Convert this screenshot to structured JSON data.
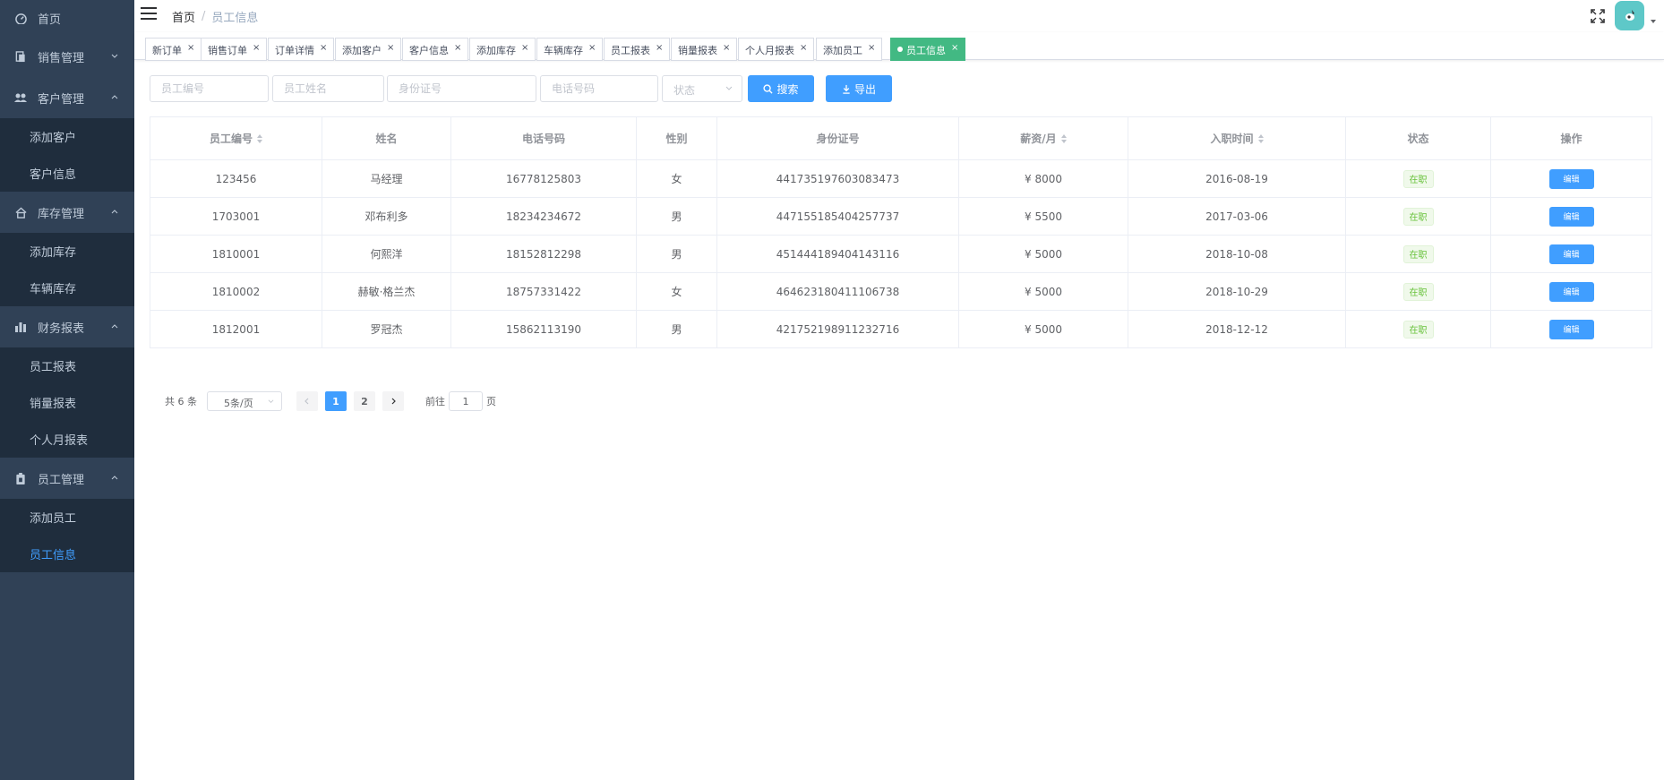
{
  "sidebar": {
    "items": [
      {
        "label": "首页",
        "icon": "dashboard-icon"
      },
      {
        "label": "销售管理",
        "icon": "document-icon",
        "expanded": false
      },
      {
        "label": "客户管理",
        "icon": "peoples-icon",
        "expanded": true,
        "children": [
          "添加客户",
          "客户信息"
        ]
      },
      {
        "label": "库存管理",
        "icon": "home-icon",
        "expanded": true,
        "children": [
          "添加库存",
          "车辆库存"
        ]
      },
      {
        "label": "财务报表",
        "icon": "bar-chart-icon",
        "expanded": true,
        "children": [
          "员工报表",
          "销量报表",
          "个人月报表"
        ]
      },
      {
        "label": "员工管理",
        "icon": "clipboard-icon",
        "expanded": true,
        "children": [
          "添加员工",
          "员工信息"
        ]
      }
    ],
    "active_child": "员工信息",
    "colors": {
      "bg": "#304156",
      "submenu_bg": "#1f2d3d",
      "text": "#bfcbd9",
      "active": "#409eff"
    }
  },
  "header": {
    "breadcrumb": {
      "home": "首页",
      "separator": "/",
      "current": "员工信息"
    }
  },
  "tags": [
    {
      "label": "新订单"
    },
    {
      "label": "销售订单"
    },
    {
      "label": "订单详情"
    },
    {
      "label": "添加客户"
    },
    {
      "label": "客户信息"
    },
    {
      "label": "添加库存"
    },
    {
      "label": "车辆库存"
    },
    {
      "label": "员工报表"
    },
    {
      "label": "销量报表"
    },
    {
      "label": "个人月报表"
    },
    {
      "label": "添加员工"
    },
    {
      "label": "员工信息",
      "active": true
    }
  ],
  "tag_close": "×",
  "filters": {
    "employee_id_placeholder": "员工编号",
    "employee_name_placeholder": "员工姓名",
    "id_card_placeholder": "身份证号",
    "phone_placeholder": "电话号码",
    "status_placeholder": "状态",
    "search_label": "搜索",
    "export_label": "导出"
  },
  "table": {
    "columns": [
      "员工编号",
      "姓名",
      "电话号码",
      "性别",
      "身份证号",
      "薪资/月",
      "入职时间",
      "状态",
      "操作"
    ],
    "rows": [
      {
        "id": "123456",
        "name": "马经理",
        "phone": "16778125803",
        "gender": "女",
        "id_card": "441735197603083473",
        "salary": "¥ 8000",
        "hire_date": "2016-08-19",
        "status": "在职",
        "action": "编辑"
      },
      {
        "id": "1703001",
        "name": "邓布利多",
        "phone": "18234234672",
        "gender": "男",
        "id_card": "447155185404257737",
        "salary": "¥ 5500",
        "hire_date": "2017-03-06",
        "status": "在职",
        "action": "编辑"
      },
      {
        "id": "1810001",
        "name": "何熙洋",
        "phone": "18152812298",
        "gender": "男",
        "id_card": "451444189404143116",
        "salary": "¥ 5000",
        "hire_date": "2018-10-08",
        "status": "在职",
        "action": "编辑"
      },
      {
        "id": "1810002",
        "name": "赫敏·格兰杰",
        "phone": "18757331422",
        "gender": "女",
        "id_card": "464623180411106738",
        "salary": "¥ 5000",
        "hire_date": "2018-10-29",
        "status": "在职",
        "action": "编辑"
      },
      {
        "id": "1812001",
        "name": "罗冠杰",
        "phone": "15862113190",
        "gender": "男",
        "id_card": "421752198911232716",
        "salary": "¥ 5000",
        "hire_date": "2018-12-12",
        "status": "在职",
        "action": "编辑"
      }
    ]
  },
  "pagination": {
    "total": "共 6 条",
    "page_size": "5条/页",
    "pages": [
      "1",
      "2"
    ],
    "current_page": "1",
    "goto_prefix": "前往",
    "goto_value": "1",
    "goto_suffix": "页"
  },
  "colors": {
    "primary": "#409eff",
    "tag_active": "#42b983",
    "success": "#67c23a",
    "avatar": "#5ec8c8"
  }
}
